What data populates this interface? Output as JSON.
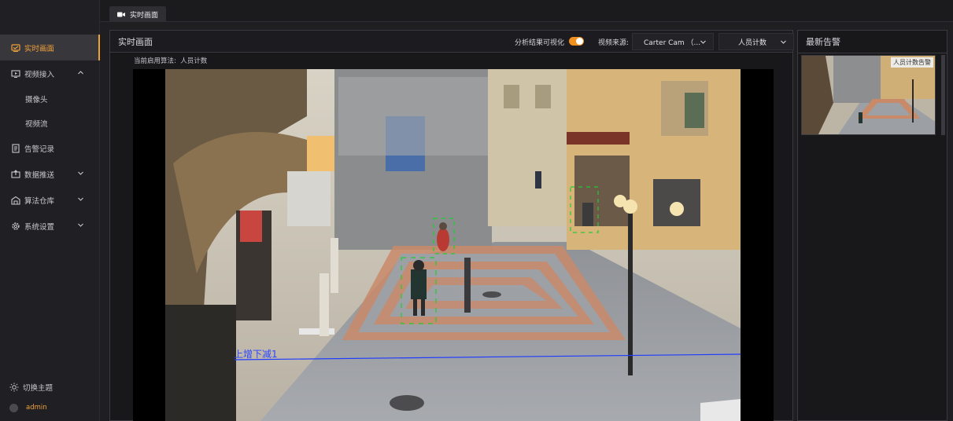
{
  "sidebar": {
    "items": [
      {
        "label": "实时画面",
        "icon": "monitor-icon",
        "active": true
      },
      {
        "label": "视频接入",
        "icon": "video-input-icon",
        "expandable": true,
        "expanded": true,
        "children": [
          {
            "label": "摄像头"
          },
          {
            "label": "视频流"
          }
        ]
      },
      {
        "label": "告警记录",
        "icon": "document-icon"
      },
      {
        "label": "数据推送",
        "icon": "push-icon",
        "expandable": true
      },
      {
        "label": "算法仓库",
        "icon": "warehouse-icon",
        "expandable": true
      },
      {
        "label": "系统设置",
        "icon": "gear-icon",
        "expandable": true
      }
    ],
    "theme_toggle": "切换主题",
    "user": "admin"
  },
  "tabs": [
    {
      "label": "实时画面",
      "icon": "camera-icon",
      "active": true
    }
  ],
  "live": {
    "title": "实时画面",
    "visualize_label": "分析结果可视化",
    "visualize_on": true,
    "source_label": "视频来源:",
    "source_value": "Carter Cam （...",
    "algo_select": "人员计数",
    "current_algo_label": "当前启用算法:",
    "current_algo_value": "人员计数",
    "counting_line_label": "上增下减1"
  },
  "alerts": {
    "title": "最新告警",
    "latest": {
      "badge": "人员计数告警"
    }
  },
  "colors": {
    "accent": "#f0a13a",
    "toggle": "#f0901f",
    "line": "#1f3bff",
    "box": "#22cc33"
  }
}
